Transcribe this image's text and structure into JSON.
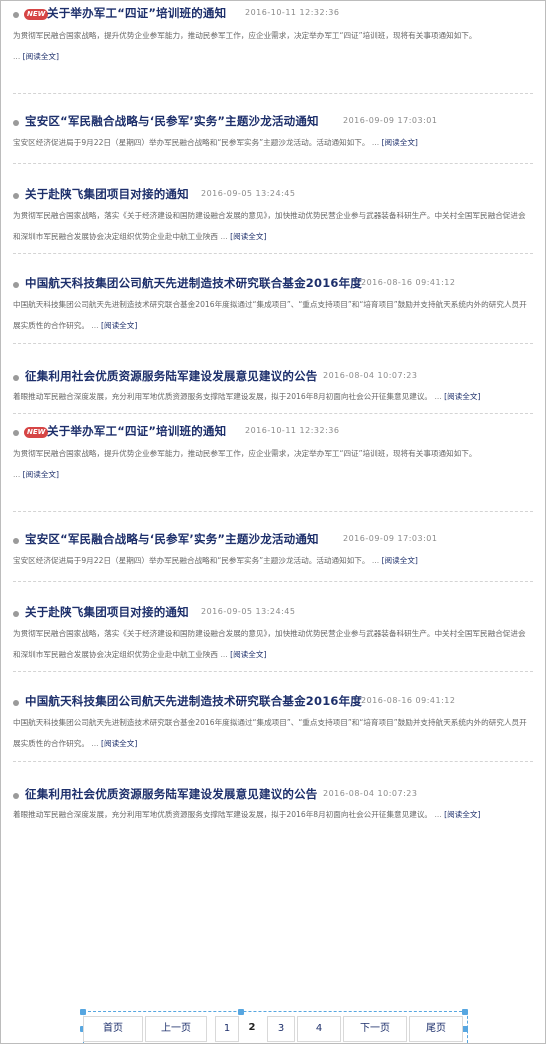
{
  "read_more": "[阅读全文]",
  "ellipsis": "...",
  "items": [
    {
      "title": "关于举办军工“四证”培训班的通知",
      "date": "2016-10-11 12:32:36",
      "badge": "NEW",
      "summary": "为贯彻军民融合国家战略，提升优势企业参军能力，推动民参军工作，应企业需求，决定举办军工“四证”培训班，现将有关事项通知如下。"
    },
    {
      "title": "宝安区“军民融合战略与‘民参军’实务”主题沙龙活动通知",
      "date": "2016-09-09 17:03:01",
      "badge": "",
      "summary": "宝安区经济促进局于9月22日（星期四）举办军民融合战略和“民参军实务”主题沙龙活动。活动通知如下。"
    },
    {
      "title": "关于赴陕飞集团项目对接的通知",
      "date": "2016-09-05 13:24:45",
      "badge": "",
      "summary": "为贯彻军民融合国家战略，落实《关于经济建设和国防建设融合发展的意见》，加快推动优势民营企业参与武器装备科研生产。中关村全国军民融合促进会和深圳市军民融合发展协会决定组织优势企业赴中航工业陕西"
    },
    {
      "title": "中国航天科技集团公司航天先进制造技术研究联合基金2016年度",
      "date": "2016-08-16 09:41:12",
      "badge": "",
      "summary": "中国航天科技集团公司航天先进制造技术研究联合基金2016年度拟通过“集成项目”、“重点支持项目”和“培育项目”鼓励并支持航天系统内外的研究人员开展实质性的合作研究。"
    },
    {
      "title": "征集利用社会优质资源服务陆军建设发展意见建议的公告",
      "date": "2016-08-04 10:07:23",
      "badge": "",
      "summary": "着眼推动军民融合深度发展，充分利用军地优质资源服务支撑陆军建设发展，拟于2016年8月初面向社会公开征集意见建议。"
    },
    {
      "title": "关于举办军工“四证”培训班的通知",
      "date": "2016-10-11 12:32:36",
      "badge": "NEW",
      "summary": "为贯彻军民融合国家战略，提升优势企业参军能力，推动民参军工作，应企业需求，决定举办军工“四证”培训班，现将有关事项通知如下。"
    },
    {
      "title": "宝安区“军民融合战略与‘民参军’实务”主题沙龙活动通知",
      "date": "2016-09-09 17:03:01",
      "badge": "",
      "summary": "宝安区经济促进局于9月22日（星期四）举办军民融合战略和“民参军实务”主题沙龙活动。活动通知如下。"
    },
    {
      "title": "关于赴陕飞集团项目对接的通知",
      "date": "2016-09-05 13:24:45",
      "badge": "",
      "summary": "为贯彻军民融合国家战略，落实《关于经济建设和国防建设融合发展的意见》，加快推动优势民营企业参与武器装备科研生产。中关村全国军民融合促进会和深圳市军民融合发展协会决定组织优势企业赴中航工业陕西"
    },
    {
      "title": "中国航天科技集团公司航天先进制造技术研究联合基金2016年度",
      "date": "2016-08-16 09:41:12",
      "badge": "",
      "summary": "中国航天科技集团公司航天先进制造技术研究联合基金2016年度拟通过“集成项目”、“重点支持项目”和“培育项目”鼓励并支持航天系统内外的研究人员开展实质性的合作研究。"
    },
    {
      "title": "征集利用社会优质资源服务陆军建设发展意见建议的公告",
      "date": "2016-08-04 10:07:23",
      "badge": "",
      "summary": "着眼推动军民融合深度发展，充分利用军地优质资源服务支撑陆军建设发展，拟于2016年8月初面向社会公开征集意见建议。"
    }
  ],
  "pagination": {
    "first": "首页",
    "prev": "上一页",
    "pages": [
      "1",
      "2",
      "3",
      "4"
    ],
    "current": "2",
    "next": "下一页",
    "last": "尾页"
  }
}
